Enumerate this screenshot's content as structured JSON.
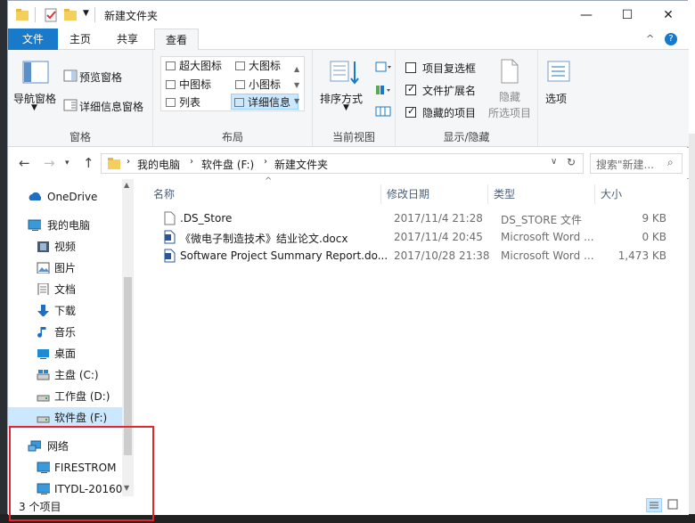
{
  "window": {
    "title": "新建文件夹",
    "minimize": "—",
    "maximize": "☐",
    "close": "✕",
    "help": "?",
    "collapse": "^"
  },
  "tabs": [
    {
      "label": "文件"
    },
    {
      "label": "主页"
    },
    {
      "label": "共享"
    },
    {
      "label": "查看"
    }
  ],
  "ribbon": {
    "panes": {
      "nav_pane": "导航窗格",
      "preview_pane": "预览窗格",
      "details_pane": "详细信息窗格",
      "group": "窗格"
    },
    "layout": {
      "items": [
        "超大图标",
        "大图标",
        "中图标",
        "小图标",
        "列表",
        "详细信息"
      ],
      "group": "布局"
    },
    "current_view": {
      "sort": "排序方式",
      "group": "当前视图"
    },
    "show_hide": {
      "item_checkbox": "项目复选框",
      "file_ext": "文件扩展名",
      "hidden_items": "隐藏的项目",
      "hide_selected_1": "隐藏",
      "hide_selected_2": "所选项目",
      "group": "显示/隐藏"
    },
    "options": "选项"
  },
  "navbar": {
    "path": [
      "我的电脑",
      "软件盘 (F:)",
      "新建文件夹"
    ],
    "search_placeholder": "搜索\"新建..."
  },
  "sidebar": [
    {
      "label": "OneDrive"
    },
    {
      "label": "我的电脑"
    },
    {
      "label": "视频"
    },
    {
      "label": "图片"
    },
    {
      "label": "文档"
    },
    {
      "label": "下载"
    },
    {
      "label": "音乐"
    },
    {
      "label": "桌面"
    },
    {
      "label": "主盘 (C:)"
    },
    {
      "label": "工作盘 (D:)"
    },
    {
      "label": "软件盘 (F:)"
    },
    {
      "label": "网络"
    },
    {
      "label": "FIRESTROM"
    },
    {
      "label": "ITYDL-20160"
    }
  ],
  "columns": [
    "名称",
    "修改日期",
    "类型",
    "大小"
  ],
  "files": [
    {
      "name": ".DS_Store",
      "date": "2017/11/4 21:28",
      "type": "DS_STORE 文件",
      "size": "9 KB"
    },
    {
      "name": "《微电子制造技术》结业论文.docx",
      "date": "2017/11/4 20:45",
      "type": "Microsoft Word ...",
      "size": "0 KB"
    },
    {
      "name": "Software Project Summary Report.do...",
      "date": "2017/10/28 21:38",
      "type": "Microsoft Word ...",
      "size": "1,473 KB"
    }
  ],
  "status": {
    "count": "3 个项目"
  },
  "colors": {
    "accent": "#1979ca",
    "selection": "#cce8ff",
    "annotation": "#e3262c"
  }
}
